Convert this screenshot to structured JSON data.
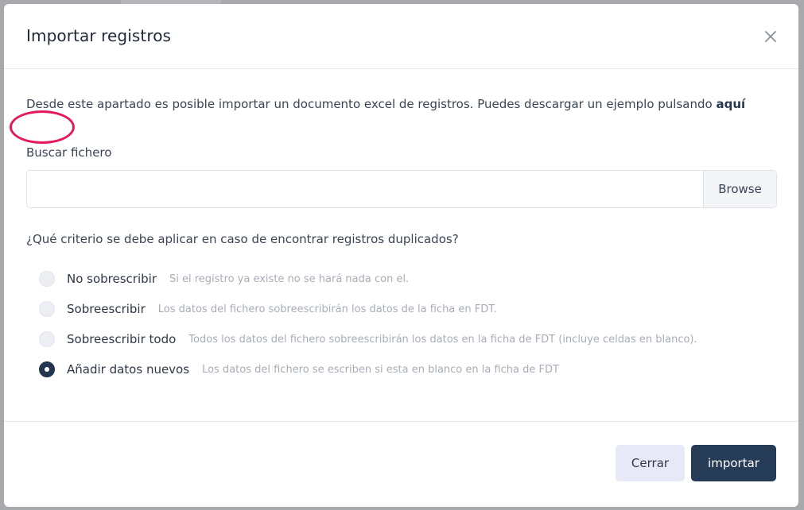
{
  "modal": {
    "title": "Importar registros",
    "intro_text": "Desde este apartado es posible importar un documento excel de registros. Puedes descargar un ejemplo pulsando ",
    "intro_link": "aquí",
    "file_label": "Buscar fichero",
    "file_value": "",
    "browse_label": "Browse",
    "question": "¿Qué criterio se debe aplicar en caso de encontrar registros duplicados?",
    "options": [
      {
        "label": "No sobrescribir",
        "hint": "Si el registro ya existe no se hará nada con el.",
        "checked": false
      },
      {
        "label": "Sobreescribir",
        "hint": "Los datos del fichero sobreescribirán los datos de la ficha en FDT.",
        "checked": false
      },
      {
        "label": "Sobreescribir todo",
        "hint": "Todos los datos del fichero sobreescribirán los datos en la ficha de FDT (incluye celdas en blanco).",
        "checked": false
      },
      {
        "label": "Añadir datos nuevos",
        "hint": "Los datos del fichero se escriben si esta en blanco en la ficha de FDT",
        "checked": true
      }
    ],
    "close_label": "Cerrar",
    "import_label": "importar"
  },
  "colors": {
    "annotation": "#e3195a",
    "primary": "#263c56",
    "secondary": "#e8e9f6"
  }
}
